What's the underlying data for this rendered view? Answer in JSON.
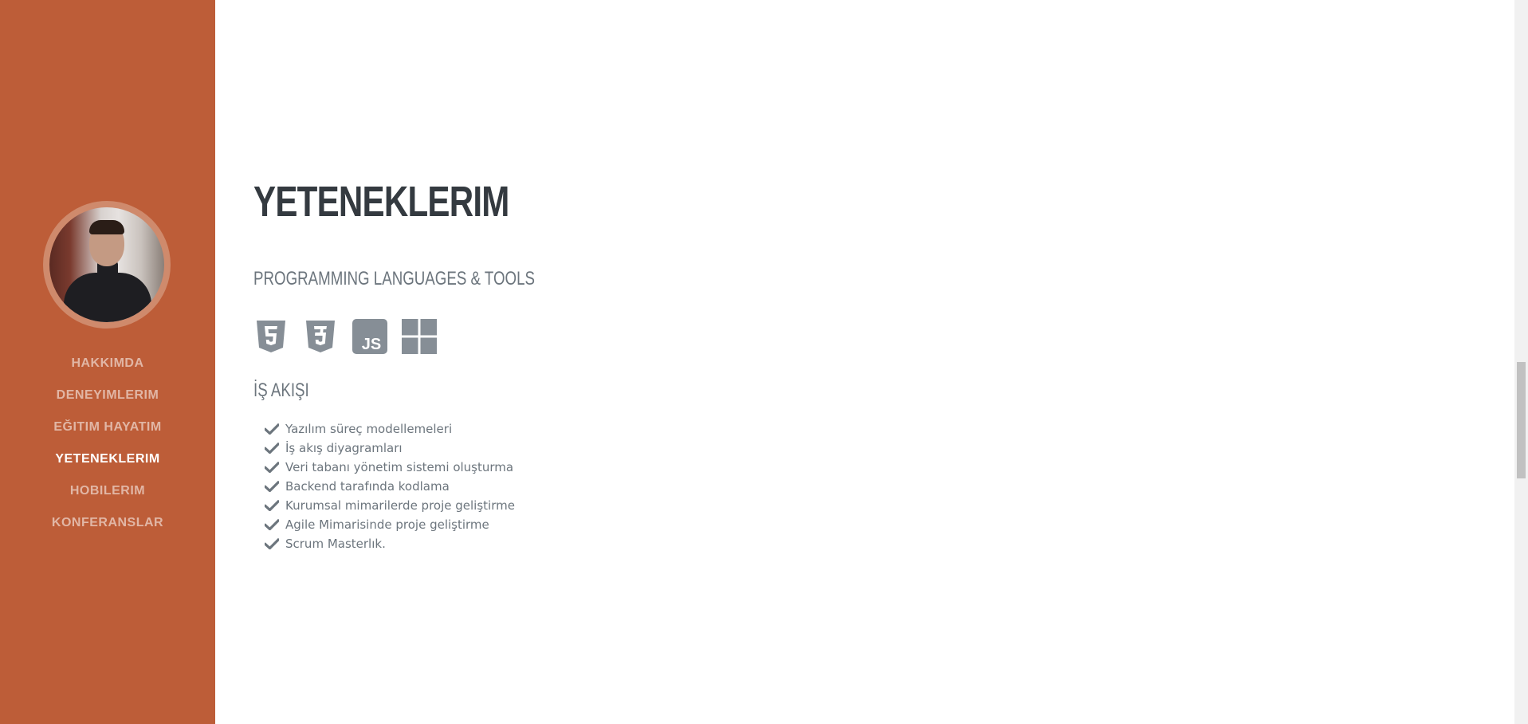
{
  "nav": {
    "items": [
      {
        "label": "HAKKIMDA",
        "active": false
      },
      {
        "label": "DENEYIMLERIM",
        "active": false
      },
      {
        "label": "EĞITIM HAYATIM",
        "active": false
      },
      {
        "label": "YETENEKLERIM",
        "active": true
      },
      {
        "label": "HOBILERIM",
        "active": false
      },
      {
        "label": "KONFERANSLAR",
        "active": false
      }
    ]
  },
  "section": {
    "title": "YETENEKLERIM",
    "tools_heading": "PROGRAMMING LANGUAGES & TOOLS",
    "tools_icons": [
      "html5-icon",
      "css3-icon",
      "js-icon",
      "windows-icon"
    ],
    "workflow_heading": "İŞ AKIŞI",
    "workflow_items": [
      "Yazılım süreç modellemeleri",
      "İş akış diyagramları",
      "Veri tabanı yönetim sistemi oluşturma",
      "Backend tarafında kodlama",
      "Kurumsal mimarilerde proje geliştirme",
      "Agile Mimarisinde proje geliştirme",
      "Scrum Masterlık."
    ]
  },
  "colors": {
    "sidebar": "#bd5d38",
    "heading": "#343a40",
    "muted": "#6c757d",
    "icon": "#868e96"
  }
}
